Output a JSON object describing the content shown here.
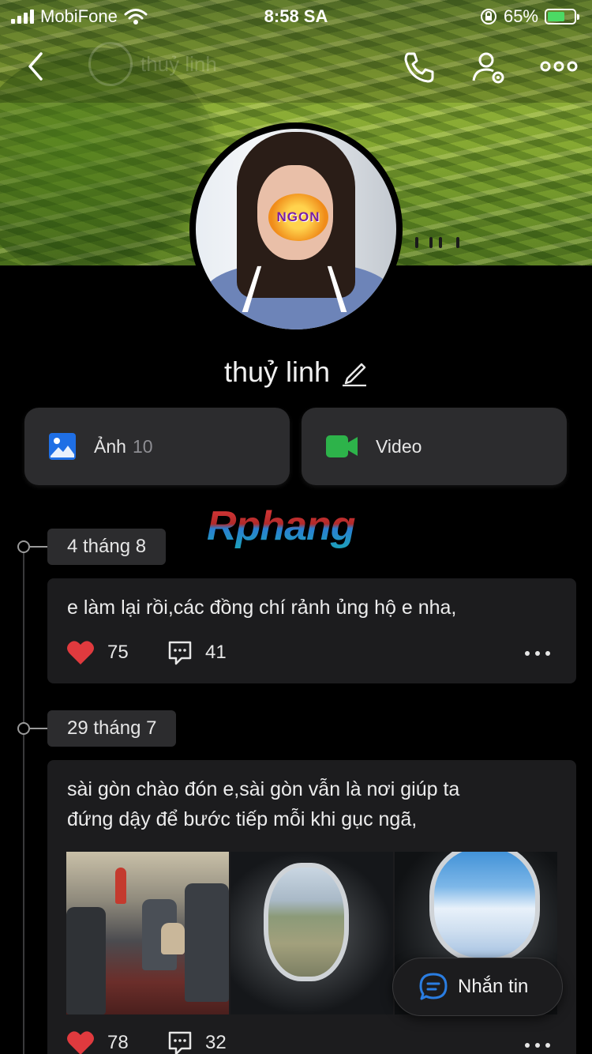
{
  "status_bar": {
    "carrier": "MobiFone",
    "time": "8:58 SA",
    "battery_percent": "65%",
    "battery_level": 0.65
  },
  "header": {
    "ghost_name": "thuỷ linh",
    "icons": [
      "back-icon",
      "phone-icon",
      "user-settings-icon",
      "more-icon"
    ]
  },
  "profile": {
    "name": "thuỷ linh",
    "avatar_sticker_text": "NGON"
  },
  "media": {
    "photos_label": "Ảnh",
    "photos_count": "10",
    "video_label": "Video"
  },
  "watermark": "Rphang",
  "posts": [
    {
      "date": "4 tháng 8",
      "text": "e làm lại rồi,các đồng chí rảnh ủng hộ e nha,",
      "likes": "75",
      "comments": "41"
    },
    {
      "date": "29 tháng 7",
      "text_line1": "sài gòn chào đón e,sài gòn vẫn là nơi giúp ta",
      "text_line2": "đứng dậy để bước tiếp mỗi khi gục ngã,",
      "likes": "78",
      "comments": "32"
    }
  ],
  "message_button": "Nhắn tin",
  "colors": {
    "background": "#000000",
    "card": "#1c1c1e",
    "chip": "#2c2c2e",
    "heart": "#e03a3e",
    "photo_icon": "#1f6fe5",
    "video_icon": "#2db34a",
    "message_icon": "#2a7de1"
  }
}
